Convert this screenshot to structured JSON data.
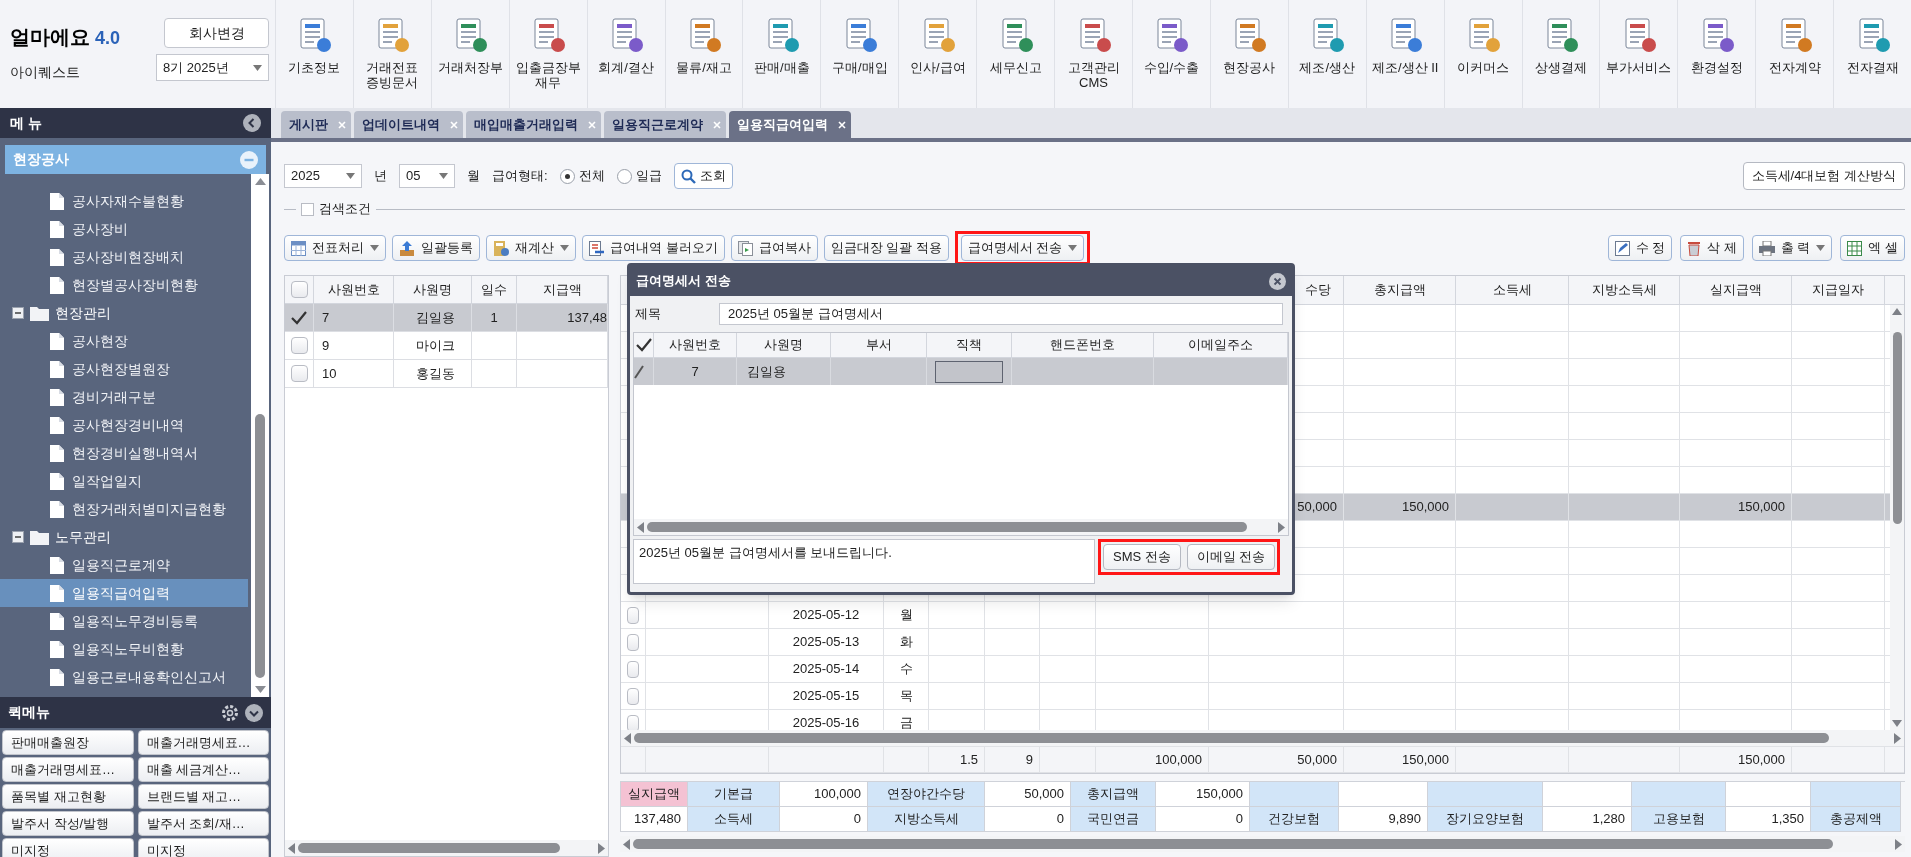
{
  "app": {
    "name": "얼마에요",
    "version": "4.0",
    "company": "아이퀘스트",
    "change_company_button": "회사변경",
    "period": "8기 2025년"
  },
  "modules": [
    {
      "label": "기초정보"
    },
    {
      "label": "거래전표\n증빙문서"
    },
    {
      "label": "거래처장부"
    },
    {
      "label": "입출금장부\n재무"
    },
    {
      "label": "회계/결산"
    },
    {
      "label": "물류/재고"
    },
    {
      "label": "판매/매출"
    },
    {
      "label": "구매/매입"
    },
    {
      "label": "인사/급여"
    },
    {
      "label": "세무신고"
    },
    {
      "label": "고객관리\nCMS"
    },
    {
      "label": "수입/수출"
    },
    {
      "label": "현장공사"
    },
    {
      "label": "제조/생산"
    },
    {
      "label": "제조/생산 II"
    },
    {
      "label": "이커머스"
    },
    {
      "label": "상생결제"
    },
    {
      "label": "부가서비스"
    },
    {
      "label": "환경설정"
    },
    {
      "label": "전자계약"
    },
    {
      "label": "전자결재"
    }
  ],
  "sidebar": {
    "title": "메 뉴",
    "section": {
      "label": "현장공사",
      "expanded": true
    },
    "tree": [
      {
        "children": [
          {
            "label": "공사자재수불현황",
            "selected": false
          },
          {
            "label": "공사장비",
            "selected": false
          },
          {
            "label": "공사장비현장배치",
            "selected": false
          },
          {
            "label": "현장별공사장비현황",
            "selected": false
          }
        ]
      },
      {
        "label": "현장관리",
        "expanded": true,
        "children": [
          {
            "label": "공사현장",
            "selected": false
          },
          {
            "label": "공사현장별원장",
            "selected": false
          },
          {
            "label": "경비거래구분",
            "selected": false
          },
          {
            "label": "공사현장경비내역",
            "selected": false
          },
          {
            "label": "현장경비실행내역서",
            "selected": false
          },
          {
            "label": "일작업일지",
            "selected": false
          },
          {
            "label": "현장거래처별미지급현황",
            "selected": false
          }
        ]
      },
      {
        "label": "노무관리",
        "expanded": true,
        "children": [
          {
            "label": "일용직근로계약",
            "selected": false
          },
          {
            "label": "일용직급여입력",
            "selected": true
          },
          {
            "label": "일용직노무경비등록",
            "selected": false
          },
          {
            "label": "일용직노무비현황",
            "selected": false
          },
          {
            "label": "일용근로내용확인신고서",
            "selected": false
          }
        ]
      }
    ],
    "quick_menu": {
      "title": "퀵메뉴",
      "items": [
        "판매매출원장",
        "매출거래명세표…",
        "매출거래명세표…",
        "매출 세금계산…",
        "품목별 재고현황",
        "브랜드별 재고…",
        "발주서 작성/발행",
        "발주서 조회/재…",
        "미지정",
        "미지정"
      ]
    }
  },
  "tabs": [
    {
      "label": "게시판",
      "selected": false
    },
    {
      "label": "업데이트내역",
      "selected": false
    },
    {
      "label": "매입매출거래입력",
      "selected": false
    },
    {
      "label": "일용직근로계약",
      "selected": false
    },
    {
      "label": "일용직급여입력",
      "selected": true
    }
  ],
  "filters": {
    "year": "2025",
    "year_unit": "년",
    "month": "05",
    "month_unit": "월",
    "pay_type_label": "급여형태:",
    "pay_types": [
      {
        "label": "전체",
        "selected": true
      },
      {
        "label": "일급",
        "selected": false
      }
    ],
    "search_button": "조회",
    "calc_button": "소득세/4대보험 계산방식"
  },
  "search_conditions": {
    "label": "검색조건",
    "checked": false
  },
  "actions": [
    {
      "label": "전표처리",
      "dropdown": true,
      "highlighted": false
    },
    {
      "label": "일괄등록",
      "dropdown": false,
      "highlighted": false
    },
    {
      "label": "재계산",
      "dropdown": true,
      "highlighted": false
    },
    {
      "label": "급여내역 불러오기",
      "dropdown": false,
      "highlighted": false
    },
    {
      "label": "급여복사",
      "dropdown": false,
      "highlighted": false
    },
    {
      "label": "임금대장 일괄 적용",
      "dropdown": false,
      "highlighted": false
    },
    {
      "label": "급여명세서 전송",
      "dropdown": true,
      "highlighted": true
    }
  ],
  "right_actions": [
    {
      "label": "수 정",
      "dropdown": false
    },
    {
      "label": "삭 제",
      "dropdown": false
    },
    {
      "label": "출 력",
      "dropdown": true
    },
    {
      "label": "엑 셀",
      "dropdown": false
    }
  ],
  "employee_grid": {
    "all_checked": false,
    "columns": [
      "사원번호",
      "사원명",
      "일수",
      "지급액"
    ],
    "rows": [
      {
        "no": "7",
        "name": "김일용",
        "days": "1",
        "amount": "137,48",
        "checked": true,
        "selected": true
      },
      {
        "no": "9",
        "name": "마이크",
        "checked": false,
        "selected": false
      },
      {
        "no": "10",
        "name": "홍길동",
        "checked": false,
        "selected": false
      }
    ]
  },
  "pay_grid": {
    "columns": [
      "수당",
      "총지급액",
      "소득세",
      "지방소득세",
      "실지급액",
      "지급일자"
    ],
    "rows": [
      {
        "selected": false
      },
      {
        "selected": false
      },
      {
        "selected": false
      },
      {
        "selected": false
      },
      {
        "selected": false
      },
      {
        "selected": false
      },
      {
        "selected": false
      },
      {
        "allowance": "50,000",
        "total": "150,000",
        "net_pay": "150,000",
        "selected": true
      },
      {
        "selected": false
      },
      {
        "selected": false
      },
      {
        "selected": false
      },
      {
        "date": "2025-05-12",
        "weekday": "월",
        "checked": false,
        "selected": false
      },
      {
        "date": "2025-05-13",
        "weekday": "화",
        "checked": false,
        "selected": false
      },
      {
        "date": "2025-05-14",
        "weekday": "수",
        "checked": false,
        "selected": false
      },
      {
        "date": "2025-05-15",
        "weekday": "목",
        "checked": false,
        "selected": false
      },
      {
        "date": "2025-05-16",
        "weekday": "금",
        "checked": false,
        "selected": false
      }
    ],
    "totals": {
      "column_5": "1.5",
      "column_6": "9",
      "column_8": "100,000",
      "allowance": "50,000",
      "total": "150,000",
      "net_pay": "150,000"
    }
  },
  "summary": {
    "rows": [
      {
        "cells": [
          {
            "kind": "highlight",
            "text": "실지급액"
          },
          {
            "kind": "label",
            "text": "기본급"
          },
          {
            "kind": "value",
            "text": "100,000"
          },
          {
            "kind": "label",
            "text": "연장야간수당"
          },
          {
            "kind": "value",
            "text": "50,000"
          },
          {
            "kind": "label",
            "text": "총지급액"
          },
          {
            "kind": "value",
            "text": "150,000"
          },
          {
            "kind": "label"
          },
          {
            "kind": "value"
          },
          {
            "kind": "label"
          },
          {
            "kind": "value"
          },
          {
            "kind": "label"
          },
          {
            "kind": "value"
          },
          {
            "kind": "label"
          }
        ]
      },
      {
        "cells": [
          {
            "kind": "value",
            "text": "137,480"
          },
          {
            "kind": "label",
            "text": "소득세"
          },
          {
            "kind": "value",
            "text": "0"
          },
          {
            "kind": "label",
            "text": "지방소득세"
          },
          {
            "kind": "value",
            "text": "0"
          },
          {
            "kind": "label",
            "text": "국민연금"
          },
          {
            "kind": "value",
            "text": "0"
          },
          {
            "kind": "label",
            "text": "건강보험"
          },
          {
            "kind": "value",
            "text": "9,890"
          },
          {
            "kind": "label",
            "text": "장기요양보험"
          },
          {
            "kind": "value",
            "text": "1,280"
          },
          {
            "kind": "label",
            "text": "고용보험"
          },
          {
            "kind": "value",
            "text": "1,350"
          },
          {
            "kind": "label",
            "text": "총공제액"
          }
        ]
      }
    ]
  },
  "dialog": {
    "title": "급여명세서 전송",
    "subject_label": "제목",
    "subject": "2025년 05월분 급여명세서",
    "all_checked": true,
    "columns": [
      "사원번호",
      "사원명",
      "부서",
      "직책",
      "핸드폰번호",
      "이메일주소"
    ],
    "rows": [
      {
        "no": "7",
        "name": "김일용",
        "selected": true
      }
    ],
    "message": "2025년 05월분 급여명세서를 보내드립니다.",
    "buttons": [
      "SMS 전송",
      "이메일 전송"
    ],
    "buttons_highlighted": true
  }
}
